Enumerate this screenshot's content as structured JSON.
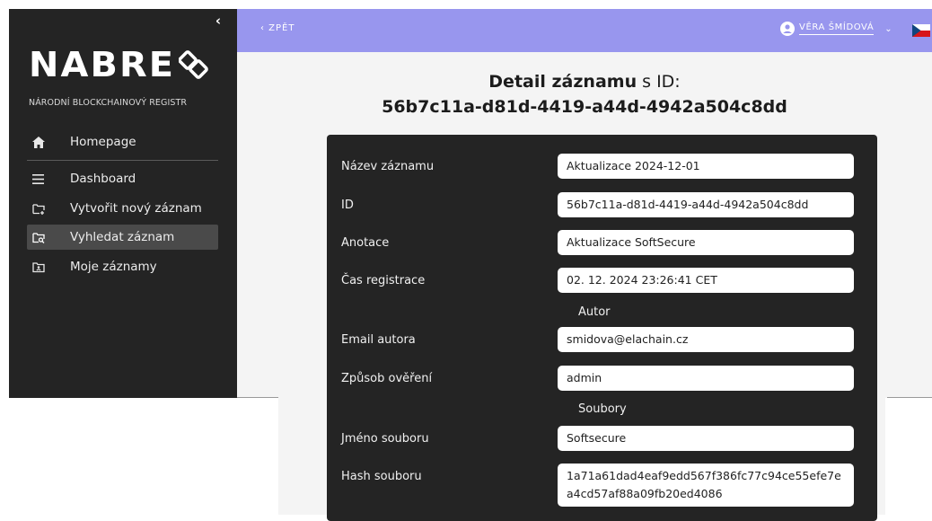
{
  "sidebar": {
    "logo_text": "NABRE",
    "subtitle": "NÁRODNÍ BLOCKCHAINOVÝ REGISTR",
    "collapse_glyph": "‹",
    "items": [
      {
        "label": "Homepage",
        "icon": "home-icon"
      },
      {
        "label": "Dashboard",
        "icon": "menu-icon"
      },
      {
        "label": "Vytvořit nový záznam",
        "icon": "folder-add-icon"
      },
      {
        "label": "Vyhledat záznam",
        "icon": "folder-search-icon",
        "active": true
      },
      {
        "label": "Moje záznamy",
        "icon": "folder-user-icon"
      }
    ]
  },
  "topbar": {
    "back_label": "‹  ZPĚT",
    "user_name": "VĚRA ŠMÍDOVÁ",
    "language_flag": "cz-flag-icon",
    "accent_color": "#9896ee"
  },
  "page": {
    "title_strong": "Detail záznamu",
    "title_light": " s ID:",
    "record_id": "56b7c11a-d81d-4419-a44d-4942a504c8dd"
  },
  "fields": {
    "nazev": {
      "label": "Název záznamu",
      "value": "Aktualizace 2024-12-01"
    },
    "id": {
      "label": "ID",
      "value": "56b7c11a-d81d-4419-a44d-4942a504c8dd"
    },
    "anotace": {
      "label": "Anotace",
      "value": "Aktualizace SoftSecure"
    },
    "cas": {
      "label": "Čas registrace",
      "value": "02. 12. 2024 23:26:41 CET"
    },
    "section_autor": "Autor",
    "email": {
      "label": "Email autora",
      "value": "smidova@elachain.cz"
    },
    "overeni": {
      "label": "Způsob ověření",
      "value": "admin"
    },
    "section_soubory": "Soubory",
    "jmeno_souboru": {
      "label": "Jméno souboru",
      "value": "Softsecure"
    },
    "hash": {
      "label": "Hash souboru",
      "value": "1a71a61dad4eaf9edd567f386fc77c94ce55efe7ea4cd57af88a09fb20ed4086"
    }
  }
}
